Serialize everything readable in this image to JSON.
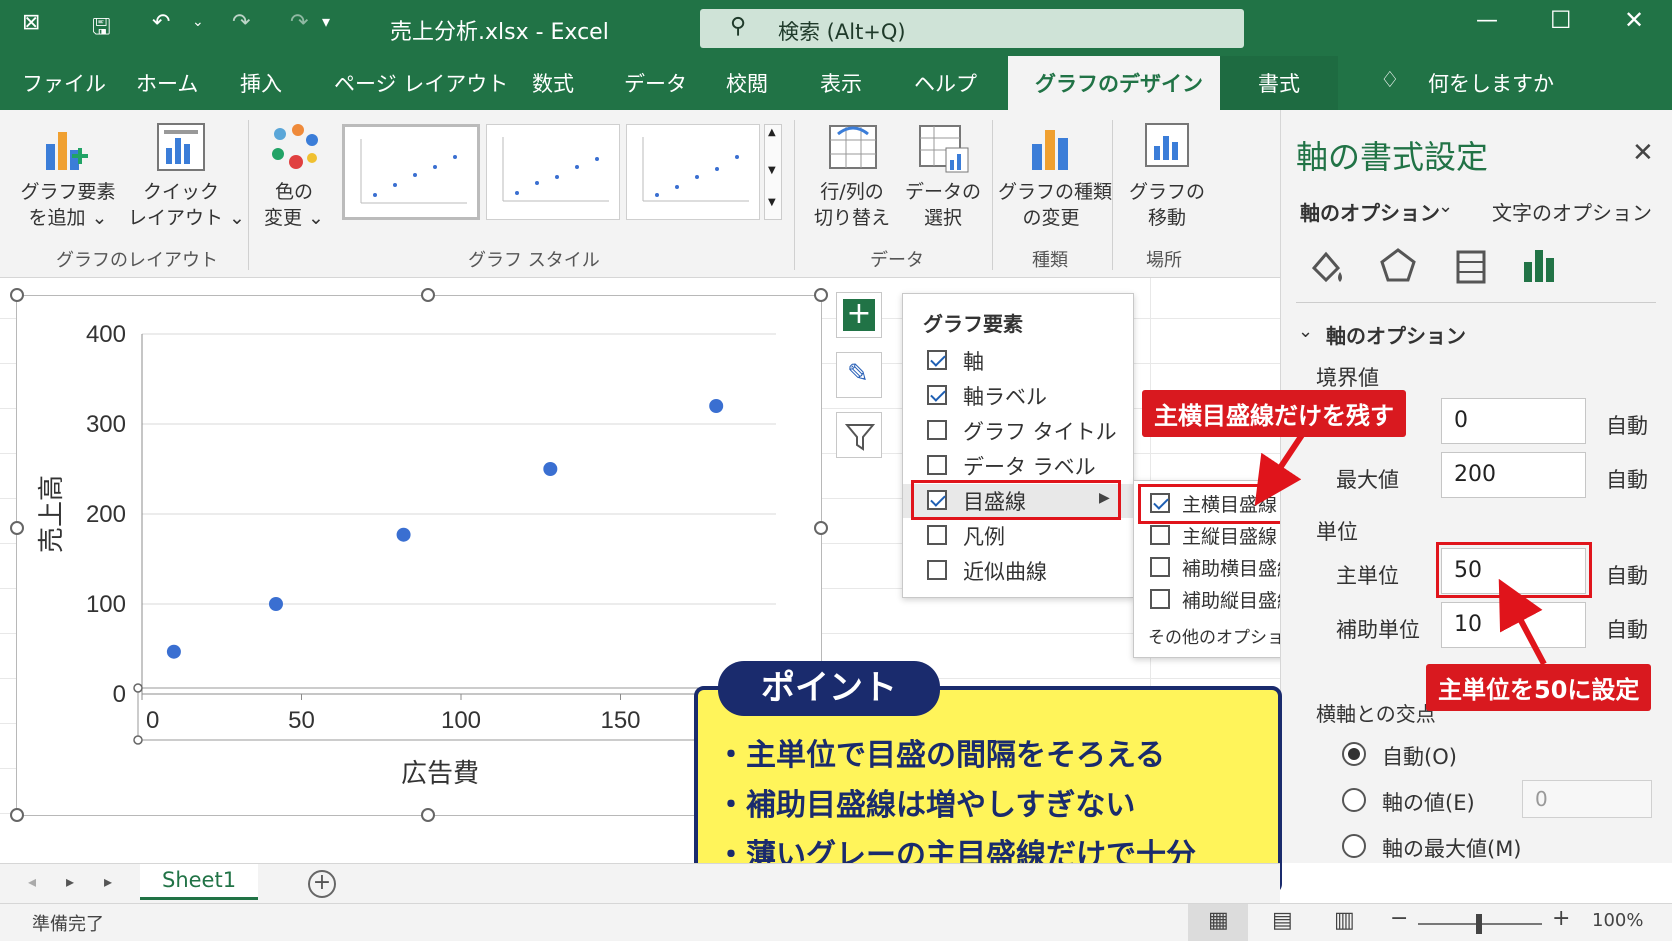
{
  "titlebar": {
    "title": "売上分析.xlsx  -  Excel",
    "search_placeholder": "検索 (Alt+Q)"
  },
  "tabs": [
    "ファイル",
    "ホーム",
    "挿入",
    "ページ レイアウト",
    "数式",
    "データ",
    "校閲",
    "表示",
    "ヘルプ"
  ],
  "tab_active": "グラフのデザイン",
  "tab_format": "書式",
  "tell_me": "何をしますか",
  "ribbon": {
    "add_element": [
      "グラフ要素",
      "を追加 ⌄"
    ],
    "quick_layout": [
      "クイック",
      "レイアウト ⌄"
    ],
    "change_color": [
      "色の",
      "変更 ⌄"
    ],
    "switch_rowcol": [
      "行/列の",
      "切り替え"
    ],
    "select_data": [
      "データの",
      "選択"
    ],
    "change_type": [
      "グラフの種類",
      "の変更"
    ],
    "move_chart": [
      "グラフの",
      "移動"
    ],
    "group_layout": "グラフのレイアウト",
    "group_style": "グラフ スタイル",
    "group_data": "データ",
    "group_type": "種類",
    "group_location": "場所"
  },
  "chart_data": {
    "type": "scatter",
    "xlabel": "広告費",
    "ylabel": "売上高",
    "xlim": [
      0,
      200
    ],
    "ylim": [
      0,
      400
    ],
    "x_ticks": [
      "0",
      "50",
      "100",
      "150"
    ],
    "y_ticks": [
      "0",
      "100",
      "200",
      "300",
      "400"
    ],
    "x": [
      10,
      42,
      82,
      128,
      180
    ],
    "y": [
      47,
      100,
      177,
      250,
      320
    ],
    "grid": "horizontal",
    "color": "#3a6fd1"
  },
  "popup": {
    "title": "グラフ要素",
    "items": [
      {
        "label": "軸",
        "checked": true
      },
      {
        "label": "軸ラベル",
        "checked": true
      },
      {
        "label": "グラフ タイトル",
        "checked": false
      },
      {
        "label": "データ ラベル",
        "checked": false
      },
      {
        "label": "目盛線",
        "checked": true
      },
      {
        "label": "凡例",
        "checked": false
      },
      {
        "label": "近似曲線",
        "checked": false
      }
    ]
  },
  "submenu": {
    "items": [
      {
        "label": "主横目盛線",
        "checked": true
      },
      {
        "label": "主縦目盛線",
        "checked": false
      },
      {
        "label": "補助横目盛線",
        "checked": false
      },
      {
        "label": "補助縦目盛線",
        "checked": false
      }
    ],
    "more": "その他のオプション..."
  },
  "pane": {
    "title": "軸の書式設定",
    "tab_axis": "軸のオプション",
    "tab_text": "文字のオプション",
    "section": "軸のオプション",
    "bounds": "境界値",
    "min_value": "0",
    "max_label": "最大値",
    "max_value": "200",
    "auto": "自動",
    "units": "単位",
    "major_label": "主単位",
    "major_value": "50",
    "minor_label": "補助単位",
    "minor_value": "10",
    "cross_label": "横軸との交点",
    "radio_auto": "自動(O)",
    "radio_value": "軸の値(E)",
    "radio_value_input": "0",
    "radio_max": "軸の最大値(M)"
  },
  "callouts": {
    "keep": "主横目盛線だけを残す",
    "set": "主単位を50に設定"
  },
  "point": {
    "heading": "ポイント",
    "lines": [
      "・主単位で目盛の間隔をそろえる",
      "・補助目盛線は増やしすぎない",
      "・薄いグレーの主目盛線だけで十分"
    ]
  },
  "sheet_tab": "Sheet1",
  "status": {
    "ready": "準備完了",
    "zoom": "100%"
  }
}
